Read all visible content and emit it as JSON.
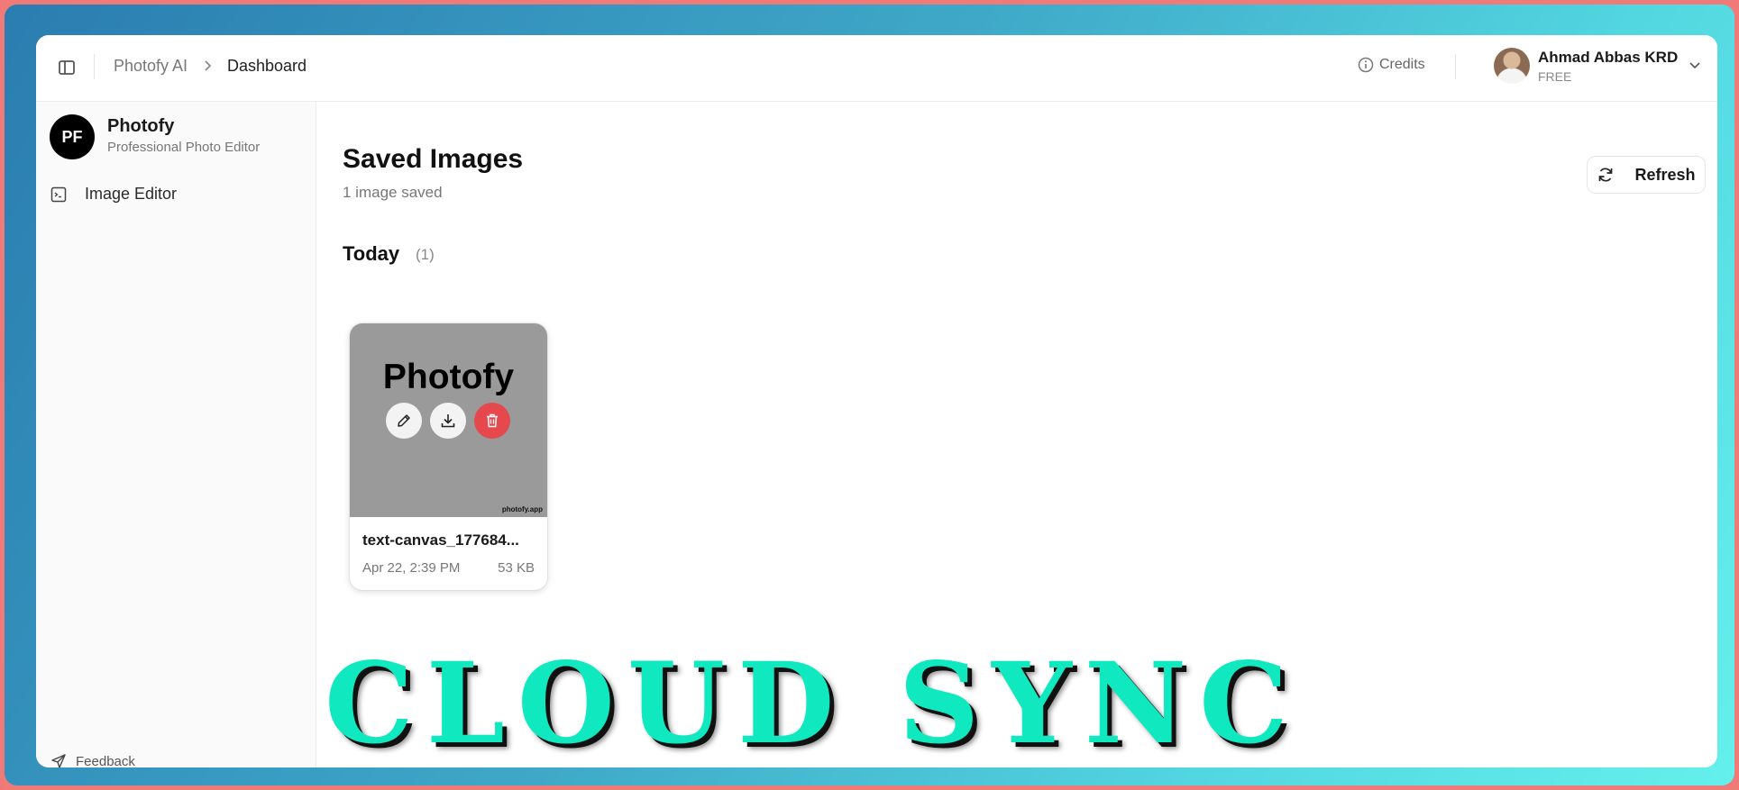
{
  "header": {
    "breadcrumb": [
      "Photofy AI",
      "Dashboard"
    ],
    "credits_label": "Credits",
    "user": {
      "name": "Ahmad Abbas KRD",
      "plan": "FREE"
    }
  },
  "sidebar": {
    "brand": {
      "initials": "PF",
      "name": "Photofy",
      "subtitle": "Professional Photo Editor"
    },
    "items": [
      {
        "label": "Image Editor",
        "icon": "image-editor-icon"
      }
    ],
    "feedback_label": "Feedback"
  },
  "main": {
    "title": "Saved Images",
    "subtitle": "1 image saved",
    "refresh_label": "Refresh",
    "groups": [
      {
        "label": "Today",
        "count": "(1)",
        "images": [
          {
            "thumbnail_text": "Photofy",
            "watermark": "photofy.app",
            "file_name": "text-canvas_177684...",
            "date": "Apr 22, 2:39 PM",
            "size": "53 KB",
            "actions": [
              "edit",
              "download",
              "delete"
            ]
          }
        ]
      }
    ]
  },
  "overlay_text": "CLOUD SYNC",
  "colors": {
    "accent_overlay": "#10e8bf",
    "delete": "#e5484d",
    "thumb_bg": "#9a9a9a"
  }
}
